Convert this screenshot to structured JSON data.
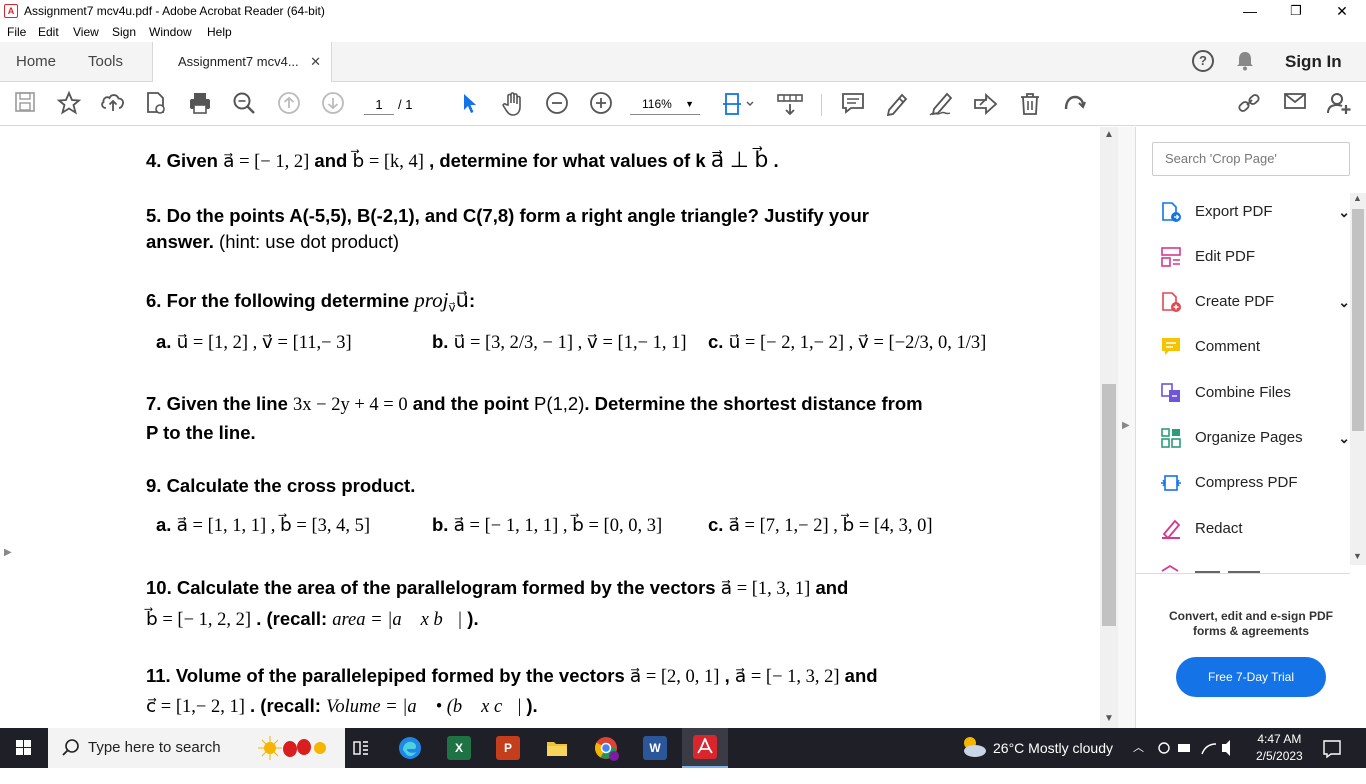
{
  "window": {
    "title": "Assignment7 mcv4u.pdf - Adobe Acrobat Reader (64-bit)",
    "minimize": "—",
    "restore": "❐",
    "close": "✕"
  },
  "menu": [
    "File",
    "Edit",
    "View",
    "Sign",
    "Window",
    "Help"
  ],
  "tabs": {
    "home": "Home",
    "tools": "Tools",
    "doc": "Assignment7 mcv4...",
    "doc_close": "✕"
  },
  "header": {
    "help": "?",
    "sign_in": "Sign In"
  },
  "toolbar": {
    "page_current": "1",
    "page_total": "/ 1",
    "zoom": "116%"
  },
  "document": {
    "q4": {
      "a": "4. Given ",
      "b": "a⃗ = [− 1, 2]",
      "c": " and ",
      "d": "b⃗ = [k, 4]",
      "e": " , determine for what values of k ",
      "f": "a⃗ ⊥ b⃗",
      "g": " ."
    },
    "q5": {
      "line1": "5. Do the points A(-5,5), B(-2,1), and C(7,8) form a right angle triangle? Justify your",
      "line2a": "answer.",
      "line2b": " (hint: use dot product)"
    },
    "q6": {
      "a": "6. For the following determine ",
      "b": "proj",
      "c": "v⃗",
      "d": "u⃗",
      "e": ":",
      "pa_l": "a. ",
      "pa": "u⃗ = [1, 2] , v⃗ = [11,− 3]",
      "pb_l": "b. ",
      "pb": "u⃗ = [3, 2/3, − 1] , v⃗ = [1,− 1, 1]",
      "pc_l": "c. ",
      "pc": "u⃗ = [− 2, 1,− 2] , v⃗ = [−2/3, 0, 1/3]"
    },
    "q7": {
      "a": "7. Given the line ",
      "b": "3x − 2y + 4 = 0",
      "c": " and the point ",
      "d": "P(1,2)",
      "e": ". Determine the shortest distance from",
      "line2": "P to the line."
    },
    "q9": {
      "title": "9. Calculate the cross product.",
      "pa_l": "a. ",
      "pa": "a⃗ = [1, 1, 1] , b⃗ = [3, 4, 5]",
      "pb_l": "b. ",
      "pb": "a⃗ = [− 1, 1, 1] , b⃗ = [0, 0, 3]",
      "pc_l": "c. ",
      "pc": "a⃗ = [7, 1,− 2] , b⃗ = [4, 3, 0]"
    },
    "q10": {
      "a": "10. Calculate the area of the parallelogram formed by the vectors ",
      "b": "a⃗ = [1, 3, 1]",
      "c": " and",
      "d": "b⃗ = [− 1, 2, 2]",
      "e": " . (recall: ",
      "f": "area = |a⃗ x b⃗|",
      "g": " )."
    },
    "q11": {
      "a": "11. Volume of the parallelepiped formed by the vectors ",
      "b": "a⃗ = [2, 0, 1]",
      "c": " , ",
      "d": "a⃗ = [− 1, 3, 2]",
      "e": "  and",
      "f": "c⃗ = [1,− 2, 1]",
      "g": " . (recall: ",
      "h": "Volume = |a⃗ • (b⃗ x c⃗| ",
      "i": ")."
    }
  },
  "right_panel": {
    "search_placeholder": "Search 'Crop Page'",
    "items": [
      {
        "label": "Export PDF",
        "color": "#1473e6"
      },
      {
        "label": "Edit PDF",
        "color": "#d83790"
      },
      {
        "label": "Create PDF",
        "color": "#e34850"
      },
      {
        "label": "Comment",
        "color": "#f5c400"
      },
      {
        "label": "Combine Files",
        "color": "#6e55d9"
      },
      {
        "label": "Organize Pages",
        "color": "#2d9d78"
      },
      {
        "label": "Compress PDF",
        "color": "#1473e6"
      },
      {
        "label": "Redact",
        "color": "#d83790"
      }
    ],
    "promo": "Convert, edit and e-sign PDF forms & agreements",
    "trial_button": "Free 7-Day Trial"
  },
  "taskbar": {
    "search_placeholder": "Type here to search",
    "weather": "26°C  Mostly cloudy",
    "time": "4:47 AM",
    "date": "2/5/2023"
  }
}
